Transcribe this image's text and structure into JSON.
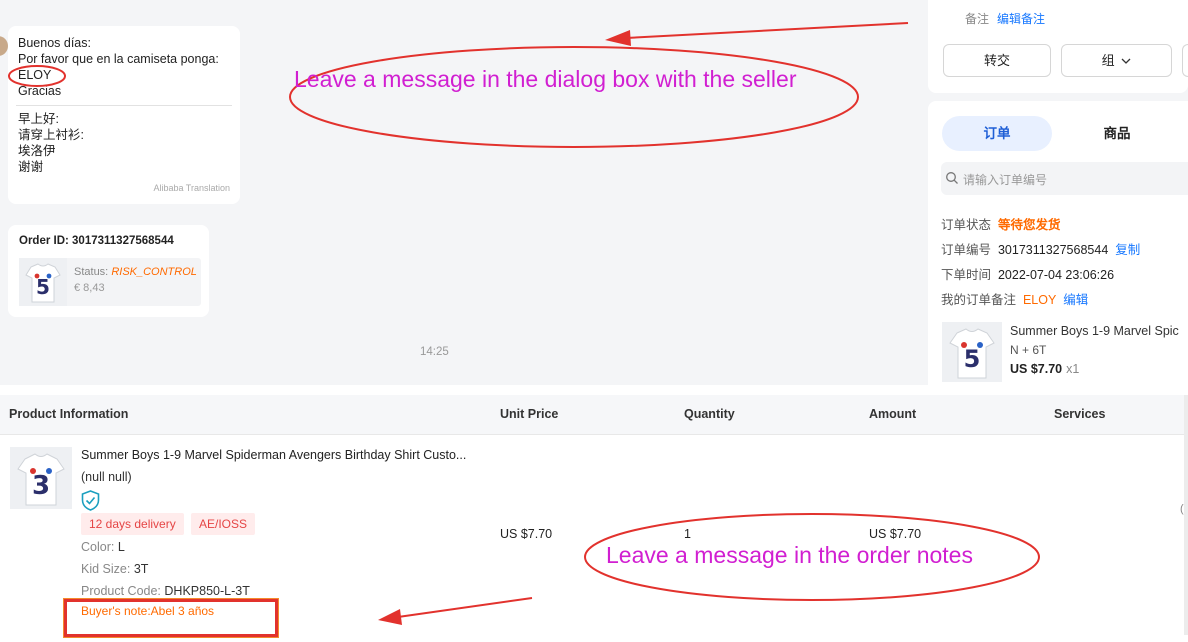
{
  "chat": {
    "message_lines": [
      "Buenos días:",
      "Por favor que en la camiseta ponga:",
      "ELOY",
      "Gracias"
    ],
    "translation_lines": [
      "早上好:",
      "请穿上衬衫:",
      "埃洛伊",
      "谢谢"
    ],
    "translation_provider": "Alibaba Translation",
    "order_card": {
      "order_id": "Order ID: 3017311327568544",
      "status_label": "Status:",
      "status_value": "RISK_CONTROL",
      "price": "€ 8,43"
    },
    "timestamp": "14:25"
  },
  "right_panel": {
    "note_label": "备注",
    "note_edit": "编辑备注",
    "buttons": {
      "transfer": "转交",
      "group": "组"
    },
    "tabs": {
      "orders": "订单",
      "products": "商品"
    },
    "search_placeholder": "请输入订单编号",
    "order_status_label": "订单状态",
    "order_status_value": "等待您发货",
    "order_number_label": "订单编号",
    "order_number_value": "3017311327568544",
    "copy_label": "复制",
    "order_time_label": "下单时间",
    "order_time_value": "2022-07-04 23:06:26",
    "my_note_label": "我的订单备注",
    "my_note_value": "ELOY",
    "my_note_edit": "编辑",
    "product": {
      "name": "Summer Boys 1-9 Marvel Spic",
      "sku": "N + 6T",
      "price": "US $7.70",
      "qty": "x1"
    }
  },
  "order_table": {
    "headers": {
      "product": "Product Information",
      "unit_price": "Unit Price",
      "quantity": "Quantity",
      "amount": "Amount",
      "services": "Services"
    },
    "row": {
      "title": "Summer Boys 1-9 Marvel Spiderman Avengers Birthday Shirt Custo...",
      "subtitle": "(null null)",
      "tags": [
        "12 days delivery",
        "AE/IOSS"
      ],
      "color_label": "Color:",
      "color_value": "L",
      "kid_size_label": "Kid Size:",
      "kid_size_value": "3T",
      "product_code_label": "Product Code:",
      "product_code_value": "DHKP850-L-3T",
      "buyer_note": "Buyer's note:Abel 3 años",
      "unit_price": "US $7.70",
      "quantity": "1",
      "amount": "US $7.70",
      "edge_glyph": "("
    }
  },
  "annotations": {
    "top_text": "Leave a message in the dialog box with the seller",
    "bottom_text": "Leave a message in the order notes",
    "color": "#d11fd1",
    "ink_color": "#e2322d"
  }
}
